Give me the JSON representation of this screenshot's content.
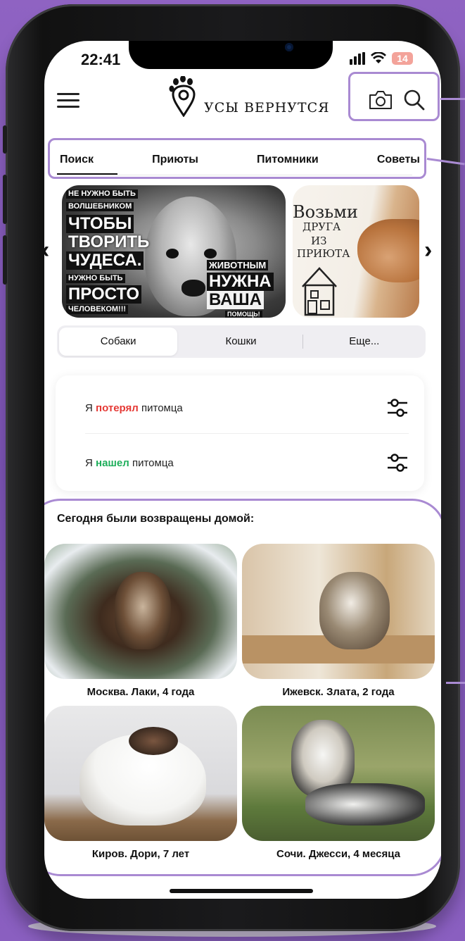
{
  "status": {
    "time": "22:41",
    "battery": "14"
  },
  "app": {
    "logo_text": "УСЫ ВЕРНУТСЯ"
  },
  "tabs": [
    {
      "label": "Поиск",
      "active": true
    },
    {
      "label": "Приюты"
    },
    {
      "label": "Питомники"
    },
    {
      "label": "Советы"
    }
  ],
  "banner1": {
    "lines_left": [
      "НЕ НУЖНО БЫТЬ",
      "ВОЛШЕБНИКОМ",
      "ЧТОБЫ",
      "ТВОРИТЬ",
      "ЧУДЕСА.",
      "НУЖНО БЫТЬ",
      "ПРОСТО",
      "ЧЕЛОВЕКОМ!!!"
    ],
    "lines_right": [
      "ЖИВОТНЫМ",
      "НУЖНА",
      "ВАША",
      "ПОМОЩЬ!"
    ]
  },
  "banner2": {
    "lines": [
      "Возьми",
      "ДРУГА",
      "ИЗ",
      "ПРИЮТА"
    ]
  },
  "segments": [
    {
      "label": "Собаки",
      "active": true
    },
    {
      "label": "Кошки"
    },
    {
      "label": "Еще..."
    }
  ],
  "lost": {
    "prefix": "Я",
    "highlight": "потерял",
    "suffix": "питомца",
    "highlight_color": "#e53935"
  },
  "found": {
    "prefix": "Я",
    "highlight": "нашел",
    "suffix": "питомца",
    "highlight_color": "#1fae5b"
  },
  "returned": {
    "title": "Сегодня были возвращены домой:",
    "items": [
      {
        "caption": "Москва. Лаки, 4 года"
      },
      {
        "caption": "Ижевск. Злата, 2 года"
      },
      {
        "caption": "Киров. Дори, 7 лет"
      },
      {
        "caption": "Сочи. Джесси, 4 месяца"
      }
    ]
  },
  "colors": {
    "accent_outline": "#a98ad2",
    "background": "#8a5fc0"
  }
}
